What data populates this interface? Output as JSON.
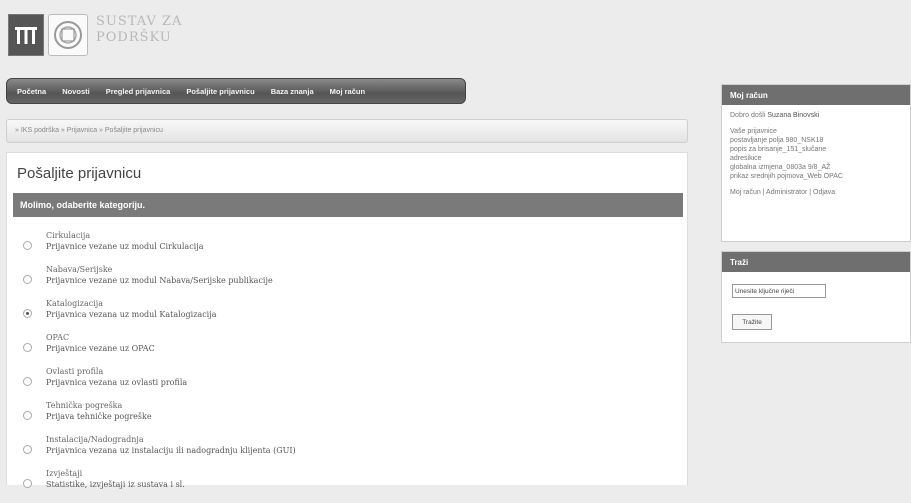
{
  "header": {
    "title_line1": "SUSTAV ZA",
    "title_line2": "PODRŠKU"
  },
  "nav": [
    "Početna",
    "Novosti",
    "Pregled prijavnica",
    "Pošaljite prijavnicu",
    "Baza znanja",
    "Moj račun"
  ],
  "breadcrumb": "» IKS podrška » Prijavnica » Pošaljite prijavnicu",
  "page_title": "Pošaljite prijavnicu",
  "category_prompt": "Molimo, odaberite kategoriju.",
  "categories": [
    {
      "title": "Cirkulacija",
      "desc": "Prijavnice vezane uz modul Cirkulacija",
      "checked": false
    },
    {
      "title": "Nabava/Serijske",
      "desc": "Prijavnice vezane uz modul Nabava/Serijske publikacije",
      "checked": false
    },
    {
      "title": "Katalogizacija",
      "desc": "Prijavnica vezana uz modul Katalogizacija",
      "checked": true
    },
    {
      "title": "OPAC",
      "desc": "Prijavnice vezane uz OPAC",
      "checked": false
    },
    {
      "title": "Ovlasti profila",
      "desc": "Prijavnica vezana uz ovlasti profila",
      "checked": false
    },
    {
      "title": "Tehnička pogreška",
      "desc": "Prijava tehničke pogreške",
      "checked": false
    },
    {
      "title": "Instalacija/Nadogradnja",
      "desc": "Prijavnica vezana uz instalaciju ili nadogradnju klijenta (GUI)",
      "checked": false
    },
    {
      "title": "Izvještaji",
      "desc": "Statistike, izvještaji iz sustava i sl.",
      "checked": false
    }
  ],
  "account_box": {
    "title": "Moj račun",
    "welcome_prefix": "Dobro došli",
    "user_name": "Suzana Binovski",
    "tickets_heading": "Vaše prijavnice",
    "tickets": [
      "postavljanje polja 980_NSK18",
      "popis za brisanje_151_slučane",
      "adresikice",
      "globalna izmjena_0803a 9/8_AŽ",
      "prikaz srednjih pojmova_Web OPAC"
    ],
    "links": "Moj račun | Administrator | Odjava"
  },
  "search_box": {
    "title": "Traži",
    "input_value": "Unesite ključne riječi",
    "button_label": "Tražite"
  }
}
